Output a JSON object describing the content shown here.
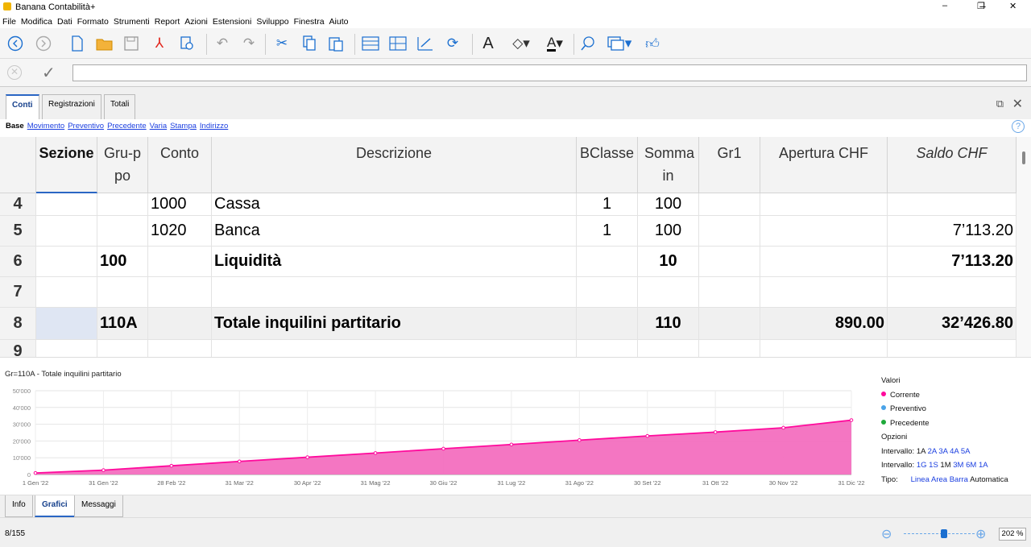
{
  "window": {
    "title": "Banana Contabilità+",
    "minimize": "–",
    "maximize": "❐",
    "close": "✕"
  },
  "menu": [
    "File",
    "Modifica",
    "Dati",
    "Formato",
    "Strumenti",
    "Report",
    "Azioni",
    "Estensioni",
    "Sviluppo",
    "Finestra",
    "Aiuto"
  ],
  "toolbar_icons": [
    "back-icon",
    "forward-icon",
    "new-file-icon",
    "open-folder-icon",
    "save-icon",
    "pdf-icon",
    "print-preview-icon",
    "undo-icon",
    "redo-icon",
    "cut-icon",
    "copy-icon",
    "paste-icon",
    "add-row-icon",
    "insert-row-icon",
    "edit-icon",
    "recheck-icon",
    "text-font-icon",
    "fill-color-icon",
    "text-color-icon",
    "search-icon",
    "windows-icon",
    "thumbs-up-icon"
  ],
  "editbar": {
    "value": ""
  },
  "tabs": [
    "Conti",
    "Registrazioni",
    "Totali"
  ],
  "views": {
    "current": "Base",
    "links": [
      "Movimento",
      "Preventivo",
      "Precedente",
      "Varia",
      "Stampa",
      "Indirizzo"
    ],
    "help": "?"
  },
  "table": {
    "headers": {
      "sezione": "Sezione",
      "gruppo": "Gru-ppo",
      "conto": "Conto",
      "descrizione": "Descrizione",
      "bclasse": "BClasse",
      "somma_in": "Somma in",
      "gr1": "Gr1",
      "apertura": "Apertura CHF",
      "saldo": "Saldo CHF"
    },
    "rows": [
      {
        "n": "4",
        "sezione": "",
        "gruppo": "",
        "conto": "1000",
        "descrizione": "Cassa",
        "bclasse": "1",
        "somma_in": "100",
        "gr1": "",
        "apertura": "",
        "saldo": ""
      },
      {
        "n": "5",
        "sezione": "",
        "gruppo": "",
        "conto": "1020",
        "descrizione": "Banca",
        "bclasse": "1",
        "somma_in": "100",
        "gr1": "",
        "apertura": "",
        "saldo": "7’113.20"
      },
      {
        "n": "6",
        "sezione": "",
        "gruppo": "100",
        "conto": "",
        "descrizione": "Liquidità",
        "bclasse": "",
        "somma_in": "10",
        "gr1": "",
        "apertura": "",
        "saldo": "7’113.20"
      },
      {
        "n": "7",
        "sezione": "",
        "gruppo": "",
        "conto": "",
        "descrizione": "",
        "bclasse": "",
        "somma_in": "",
        "gr1": "",
        "apertura": "",
        "saldo": ""
      },
      {
        "n": "8",
        "sezione": "",
        "gruppo": "110A",
        "conto": "",
        "descrizione": "Totale inquilini partitario",
        "bclasse": "",
        "somma_in": "110",
        "gr1": "",
        "apertura": "890.00",
        "saldo": "32’426.80"
      },
      {
        "n": "9",
        "sezione": "",
        "gruppo": "",
        "conto": "",
        "descrizione": "",
        "bclasse": "",
        "somma_in": "",
        "gr1": "",
        "apertura": "",
        "saldo": ""
      }
    ]
  },
  "chart_title": "Gr=110A - Totale inquilini partitario",
  "chart_data": {
    "type": "area",
    "x": [
      "1 Gen '22",
      "31 Gen '22",
      "28 Feb '22",
      "31 Mar '22",
      "30 Apr '22",
      "31 Mag '22",
      "30 Giu '22",
      "31 Lug '22",
      "31 Ago '22",
      "30 Set '22",
      "31 Ott '22",
      "30 Nov '22",
      "31 Dic '22"
    ],
    "series": [
      {
        "name": "Corrente",
        "values": [
          890,
          2600,
          5200,
          7800,
          10300,
          12800,
          15400,
          17900,
          20500,
          23000,
          25300,
          27900,
          32426.8
        ]
      }
    ],
    "yticks": [
      "0",
      "10'000",
      "20'000",
      "30'000",
      "40'000",
      "50'000"
    ],
    "ylim": [
      0,
      50000
    ],
    "grid": true,
    "color": "#ff0a9c",
    "fill": "#f36fbf"
  },
  "legend": {
    "title": "Valori",
    "items": [
      {
        "label": "Corrente",
        "color": "#ff0a9c"
      },
      {
        "label": "Preventivo",
        "color": "#4aa3e8"
      },
      {
        "label": "Precedente",
        "color": "#1ea93a"
      }
    ],
    "options_title": "Opzioni",
    "intervallo1_label": "Intervallo:",
    "intervallo1": [
      "1A",
      "2A",
      "3A",
      "4A",
      "5A"
    ],
    "intervallo2_label": "Intervallo:",
    "intervallo2": [
      "1G",
      "1S",
      "1M",
      "3M",
      "6M",
      "1A"
    ],
    "tipo_label": "Tipo:",
    "tipo": [
      "Linea",
      "Area",
      "Barra",
      "Automatica"
    ]
  },
  "bottom_tabs": [
    "Info",
    "Grafici",
    "Messaggi"
  ],
  "status": {
    "position": "8/155",
    "zoom": "202 %"
  }
}
